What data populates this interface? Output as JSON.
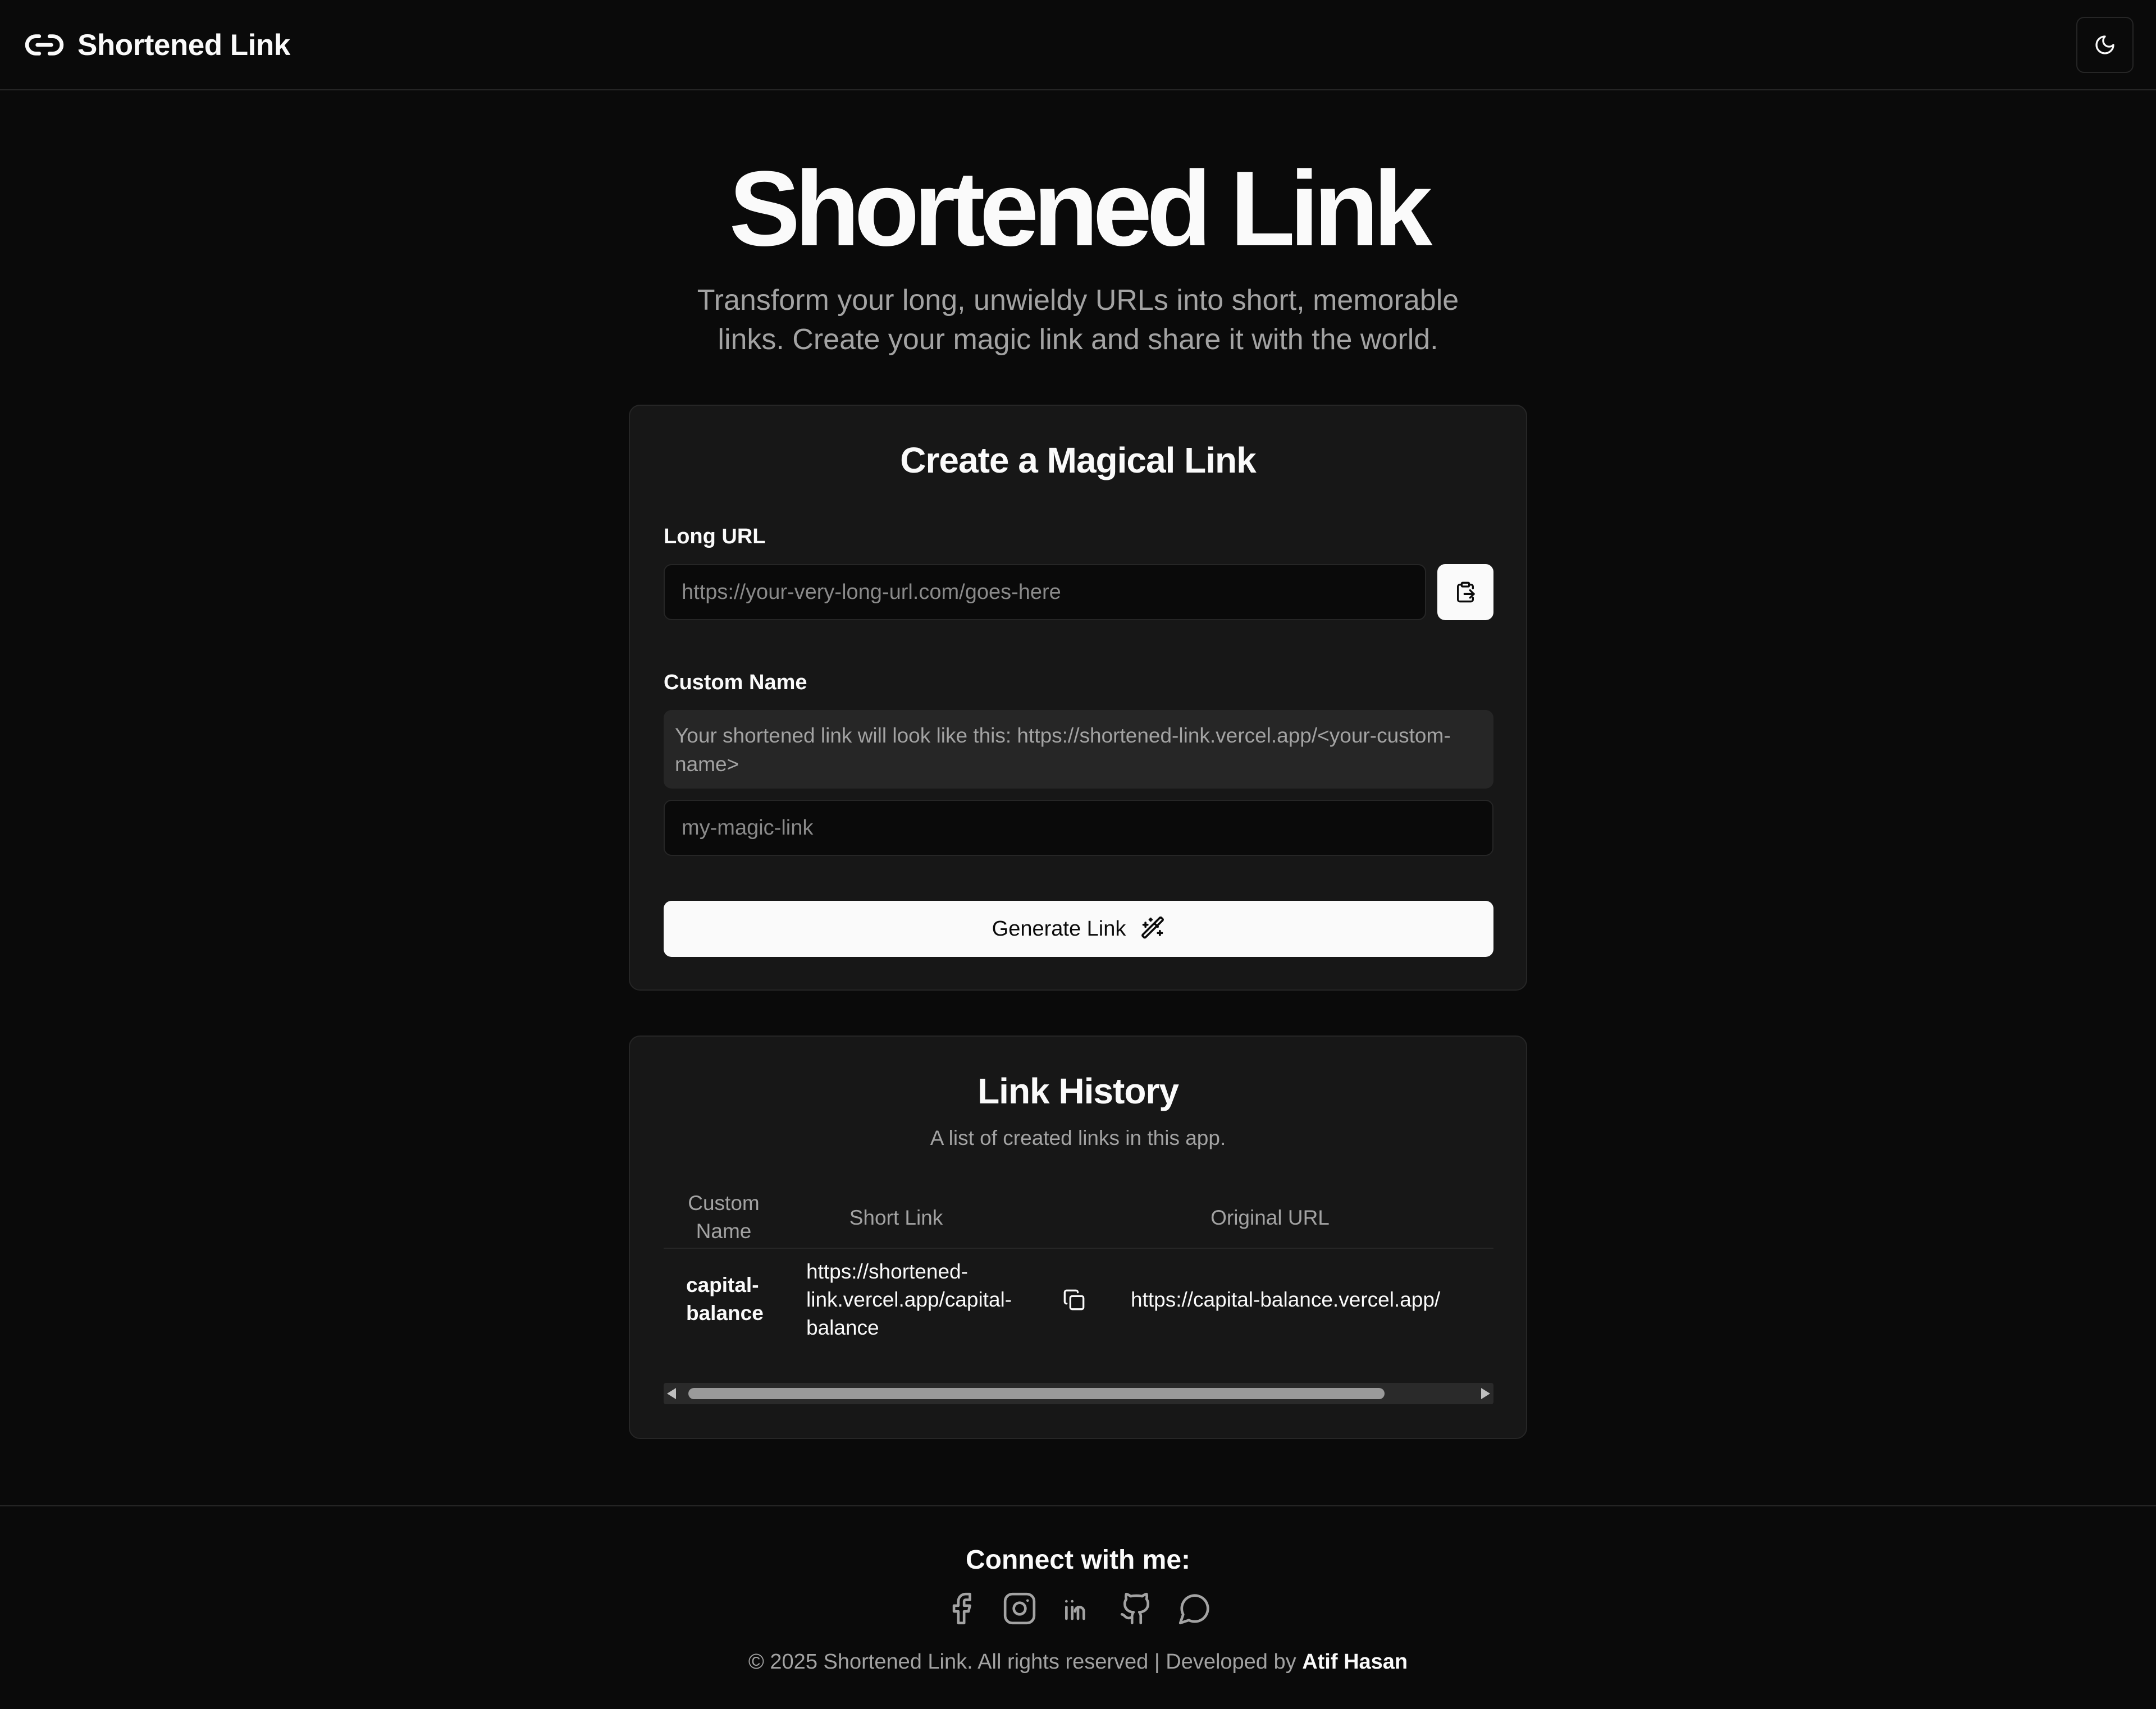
{
  "header": {
    "brand": "Shortened Link",
    "brand_icon": "link-icon",
    "theme_toggle_icon": "moon-icon"
  },
  "hero": {
    "title": "Shortened Link",
    "subtitle": "Transform your long, unwieldy URLs into short, memorable links. Create your magic link and share it with the world."
  },
  "create_card": {
    "title": "Create a Magical Link",
    "long_url_label": "Long URL",
    "long_url_placeholder": "https://your-very-long-url.com/goes-here",
    "long_url_value": "",
    "paste_icon": "clipboard-paste-icon",
    "custom_name_label": "Custom Name",
    "custom_name_hint": "Your shortened link will look like this: https://shortened-link.vercel.app/<your-custom-name>",
    "custom_name_placeholder": "my-magic-link",
    "custom_name_value": "",
    "generate_label": "Generate Link",
    "generate_icon": "magic-wand-icon"
  },
  "history": {
    "title": "Link History",
    "subtitle": "A list of created links in this app.",
    "columns": [
      "Custom Name",
      "Short Link",
      "Original URL"
    ],
    "rows": [
      {
        "custom_name": "capital-balance",
        "short_link": "https://shortened-link.vercel.app/capital-balance",
        "original_url": "https://capital-balance.vercel.app/"
      }
    ],
    "copy_icon": "copy-icon"
  },
  "footer": {
    "connect": "Connect with me:",
    "socials": [
      "facebook-icon",
      "instagram-icon",
      "linkedin-icon",
      "github-icon",
      "whatsapp-icon"
    ],
    "copyright_prefix": "© 2025 Shortened Link. All rights reserved | Developed by",
    "author": "Atif Hasan"
  },
  "colors": {
    "background": "#0a0a0a",
    "card": "#171717",
    "border": "#262626",
    "foreground": "#fafafa",
    "muted": "#a3a3a3"
  }
}
